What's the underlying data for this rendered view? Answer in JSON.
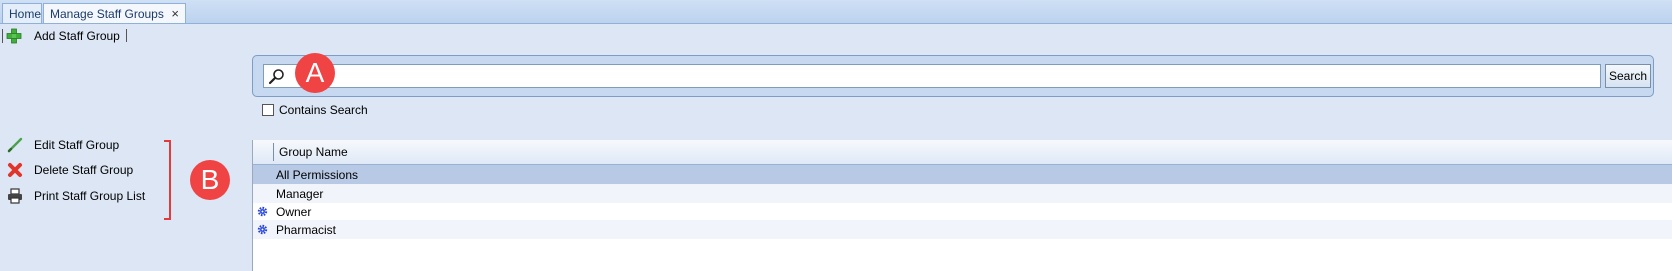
{
  "tabs": [
    {
      "label": "Home"
    },
    {
      "label": "Manage Staff Groups",
      "close": "×"
    }
  ],
  "toolbar": {
    "add_label": "Add Staff Group"
  },
  "search": {
    "value": "",
    "placeholder": "",
    "button_label": "Search",
    "contains_label": "Contains Search",
    "contains_checked": false
  },
  "actions": [
    {
      "label": "Edit Staff Group",
      "icon": "pencil-icon"
    },
    {
      "label": "Delete Staff Group",
      "icon": "delete-x-icon"
    },
    {
      "label": "Print Staff Group List",
      "icon": "printer-icon"
    }
  ],
  "grid": {
    "column": "Group Name",
    "rows": [
      {
        "name": "All Permissions",
        "selected": true,
        "icon": ""
      },
      {
        "name": "Manager",
        "selected": false,
        "icon": ""
      },
      {
        "name": "Owner",
        "selected": false,
        "icon": "gear-icon"
      },
      {
        "name": "Pharmacist",
        "selected": false,
        "icon": "gear-icon"
      }
    ]
  },
  "markers": {
    "a": "A",
    "b": "B"
  },
  "colors": {
    "accent": "#ef4344",
    "selected_row": "#b7c9e4",
    "background": "#dce6f4"
  }
}
